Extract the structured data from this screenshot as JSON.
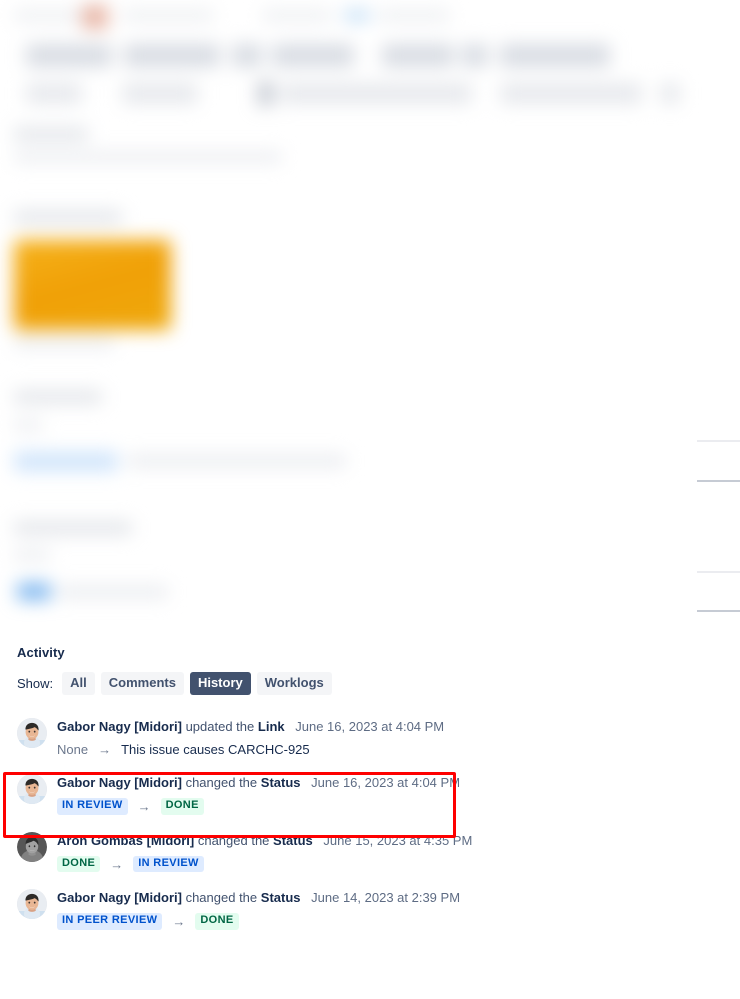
{
  "page": {
    "redacted_top": {
      "note": "upper portion of the issue view is blurred/redacted",
      "accent_orange": "#f0a007",
      "accent_blue": "#7db6ef"
    }
  },
  "activity": {
    "heading": "Activity",
    "show_label": "Show:",
    "filters": [
      {
        "label": "All",
        "active": false
      },
      {
        "label": "Comments",
        "active": false
      },
      {
        "label": "History",
        "active": true
      },
      {
        "label": "Worklogs",
        "active": false
      }
    ],
    "entries": [
      {
        "actor": "Gabor Nagy [Midori]",
        "verb": "updated the",
        "field": "Link",
        "date": "June 16, 2023 at 4:04 PM",
        "avatar": "photo-color",
        "from": {
          "text": "None",
          "style": "plain"
        },
        "to": {
          "text": "This issue causes CARCHC-925",
          "style": "plain-dark"
        },
        "highlighted": false
      },
      {
        "actor": "Gabor Nagy [Midori]",
        "verb": "changed the",
        "field": "Status",
        "date": "June 16, 2023 at 4:04 PM",
        "avatar": "photo-color",
        "from": {
          "text": "IN REVIEW",
          "style": "lozenge-blue"
        },
        "to": {
          "text": "DONE",
          "style": "lozenge-green"
        },
        "highlighted": true
      },
      {
        "actor": "Aron Gombas [Midori]",
        "verb": "changed the",
        "field": "Status",
        "date": "June 15, 2023 at 4:35 PM",
        "avatar": "photo-gray",
        "from": {
          "text": "DONE",
          "style": "lozenge-green"
        },
        "to": {
          "text": "IN REVIEW",
          "style": "lozenge-blue"
        },
        "highlighted": false
      },
      {
        "actor": "Gabor Nagy [Midori]",
        "verb": "changed the",
        "field": "Status",
        "date": "June 14, 2023 at 2:39 PM",
        "avatar": "photo-color",
        "from": {
          "text": "IN PEER REVIEW",
          "style": "lozenge-blue"
        },
        "to": {
          "text": "DONE",
          "style": "lozenge-green"
        },
        "highlighted": false
      }
    ],
    "arrow_glyph": "→"
  },
  "annotation": {
    "color": "#fe0000",
    "target": "status-change-entry-2023-06-16"
  }
}
